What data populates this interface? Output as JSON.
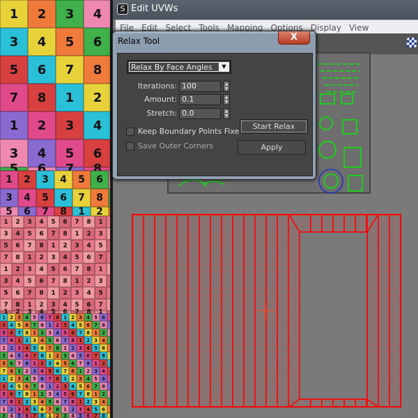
{
  "window": {
    "title": "Edit UVWs",
    "app_icon": "3ds-max-icon"
  },
  "menu": [
    "File",
    "Edit",
    "Select",
    "Tools",
    "Mapping",
    "Options",
    "Display",
    "View"
  ],
  "dialog": {
    "title": "Relax Tool",
    "close_label": "X",
    "method": "Relax By Face Angles",
    "iterations_label": "Iterations:",
    "iterations": "100",
    "amount_label": "Amount:",
    "amount": "0.1",
    "stretch_label": "Stretch:",
    "stretch": "0.0",
    "keep_boundary_label": "Keep Boundary Points Fixed",
    "keep_boundary": false,
    "save_corners_label": "Save Outer Corners",
    "save_corners": false,
    "start_relax_label": "Start Relax",
    "apply_label": "Apply"
  },
  "texture_digits": [
    "1",
    "2",
    "3",
    "4",
    "5",
    "6",
    "7",
    "8"
  ],
  "colors": {
    "uv_edges": "#ff0000",
    "uv_background": "#7a7a7a",
    "dialog_bg": "#444444",
    "upper_uvs": "#00ff00"
  }
}
